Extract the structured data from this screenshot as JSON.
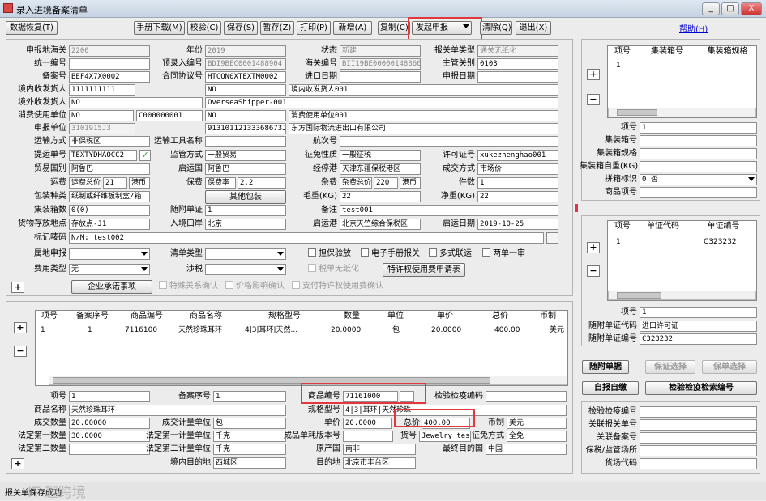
{
  "window": {
    "title": "录入进境备案清单",
    "minimize": "_",
    "maximize": "□",
    "close": "X"
  },
  "help_link": "帮助(H)",
  "toolbar": {
    "extra_button": "数据恢复(T)",
    "buttons": [
      "手册下载(M)",
      "校验(C)",
      "保存(S)",
      "暂存(Z)",
      "打印(P)",
      "新增(A)",
      "复制(C)",
      "发起申报",
      "清除(Q)",
      "退出(X)"
    ]
  },
  "header": {
    "row1": {
      "l1": "申报地海关",
      "v1": "2200",
      "l2": "年份",
      "v2": "2019",
      "l3": "状态",
      "v3": "新建",
      "l4": "报关单类型",
      "v4": "通关无纸化"
    },
    "row2": {
      "l1": "统一编号",
      "v1": "",
      "l2": "预录入编号",
      "v2": "BDI9BEC0001488904",
      "l3": "海关编号",
      "v3": "BII19BE000001488664",
      "l4": "主管关别",
      "v4": "0103"
    },
    "row3": {
      "l1": "备案号",
      "v1": "BEF4X7X0002",
      "l2": "合同协议号",
      "v2": "HTCON0XTEXTM0002",
      "l3": "进口日期",
      "v3": "",
      "l4": "申报日期",
      "v4": ""
    },
    "row4": {
      "l1": "境内收发货人",
      "v1": "1111111111",
      "v2": "NO",
      "v3": "境内收发货人001"
    },
    "row5": {
      "l1": "境外收发货人",
      "v1": "NO",
      "v2": "OverseaShipper-001"
    },
    "row6": {
      "l1": "消费使用单位",
      "v1": "NO",
      "v2": "C000000001",
      "v3": "NO",
      "v4": "消费使用单位001"
    },
    "row7": {
      "l1": "申报单位",
      "v1": "3101915J3",
      "v2": "91310112133368673J",
      "v3": "东方国际物流进出口有限公司"
    },
    "row8": {
      "l1": "运输方式",
      "v1": "非保税区",
      "l2": "运输工具名称",
      "v2": "",
      "l3": "航次号",
      "v3": ""
    },
    "row9": {
      "l1": "提运单号",
      "v1": "TEXTYDHAOCC2",
      "l2": "监管方式",
      "v2": "一般贸易",
      "l3": "征免性质",
      "v3": "一般征税",
      "l4": "许可证号",
      "v4": "xukezhenghao001"
    },
    "row10": {
      "l1": "贸易国别",
      "v1": "阿鲁巴",
      "l2": "启运国",
      "v2": "阿鲁巴",
      "l3": "经停港",
      "v3": "天津东疆保税港区",
      "l4": "成交方式",
      "v4": "市场价"
    },
    "row11": {
      "l1": "运费",
      "v1a": "运费总价",
      "v1b": "21",
      "v1c": "港币",
      "l2": "保费",
      "v2a": "保费率",
      "v2b": "2.2",
      "l3": "杂费",
      "v3a": "杂费总价",
      "v3b": "220",
      "v3c": "港币",
      "l4": "件数",
      "v4": "1"
    },
    "row12": {
      "l1": "包装种类",
      "v1": "纸制或纤维板制盒/箱",
      "btn": "其他包装",
      "l3": "毛重(KG)",
      "v3": "22",
      "l4": "净重(KG)",
      "v4": "22"
    },
    "row13": {
      "l1": "集装箱数",
      "v1": "0(0)",
      "l2": "随附单证",
      "v2": "1",
      "l3": "备注",
      "v3": "test001"
    },
    "row14": {
      "l1": "货物存放地点",
      "v1": "存放点-J1",
      "l2": "入境口岸",
      "v2": "北京",
      "l3": "启运港",
      "v3": "北京天竺综合保税区",
      "l4": "启运日期",
      "v4": "2019-10-25"
    },
    "row15": {
      "l1": "标记唛码",
      "v1": "N/M; test002"
    }
  },
  "options": {
    "l1": "属地申报",
    "v1": "",
    "l2": "清单类型",
    "v2": "",
    "l3": "涉税",
    "v3": "",
    "l4": "费用类型",
    "v4": "无",
    "checks": [
      "担保验放",
      "电子手册报关",
      "多式联运",
      "两单一审"
    ],
    "check_disabled": "税单无纸化",
    "btn_edit": "特许权使用费申请表",
    "btn_promise": "企业承诺事项",
    "checks2": [
      "特殊关系确认",
      "价格影响确认",
      "支付特许权使用费确认"
    ]
  },
  "container": {
    "headers": [
      "项号",
      "集装箱号",
      "集装箱规格"
    ],
    "row": [
      "1",
      "",
      ""
    ],
    "l1": "项号",
    "v1": "1",
    "l2": "集装箱号",
    "v2": "",
    "l3": "集装箱规格",
    "v3": "",
    "l4": "集装箱自重(KG)",
    "v4": "",
    "l5": "拼箱标识",
    "v5": "0 否",
    "l6": "商品项号",
    "v6": ""
  },
  "docs": {
    "headers": [
      "项号",
      "单证代码",
      "单证编号"
    ],
    "row": [
      "1",
      "",
      "C323232"
    ],
    "l1": "项号",
    "v1": "1",
    "l2": "随附单证代码",
    "v2": "进口许可证",
    "l3": "随附单证编号",
    "v3": "C323232"
  },
  "buttons_right": {
    "b1": "随附单据",
    "b2": "保证选择",
    "b3": "保单选择",
    "b4": "自报自缴",
    "b5": "检验检疫检索编号"
  },
  "goods_grid": {
    "headers": [
      "项号",
      "备案序号",
      "商品编号",
      "商品名称",
      "规格型号",
      "数量",
      "单位",
      "单价",
      "总价",
      "币制"
    ],
    "rows": [
      [
        "1",
        "1",
        "7116100",
        "天然珍珠耳环",
        "4|3|耳环|天然...",
        "20.0000",
        "包",
        "20.0000",
        "400.00",
        "美元"
      ]
    ]
  },
  "goods_detail": {
    "l1": "项号",
    "v1": "1",
    "l2": "备案序号",
    "v2": "1",
    "l3": "商品编号",
    "v3": "71161000",
    "l3b": "检验检疫编码",
    "v3b": "",
    "l4": "商品名称",
    "v4": "天然珍珠耳环",
    "l5": "规格型号",
    "v5": "4|3|耳环|天然珍珠",
    "l6": "成交数量",
    "v6": "20.00000",
    "l7": "成交计量单位",
    "v7": "包",
    "l8": "单价",
    "v8": "20.0000",
    "l9": "币制",
    "v9": "美元",
    "l8b": "总价",
    "v8b": "400.00",
    "l10": "法定第一数量",
    "v10": "30.0000",
    "l11": "法定第一计量单位",
    "v11": "千克",
    "l12": "成品单耗版本号",
    "v12": "",
    "l13": "货号",
    "v13": "Jewelry_test",
    "l14": "征免方式",
    "v14": "全免",
    "l15": "法定第二数量",
    "v15": "",
    "l16": "法定第二计量单位",
    "v16": "千克",
    "l17": "原产国",
    "v17": "南非",
    "l18": "最终目的国",
    "v18": "中国",
    "l19": "境内目的地",
    "v19": "西城区",
    "l20": "目的地",
    "v20": "北京市丰台区"
  },
  "inspection": {
    "labels": [
      "检验检疫编号",
      "关联报关单号",
      "关联备案号",
      "保税/监管场所",
      "货场代码"
    ]
  },
  "status": {
    "text": "报关单保存成功",
    "watermark": "IT 趣跨境"
  }
}
